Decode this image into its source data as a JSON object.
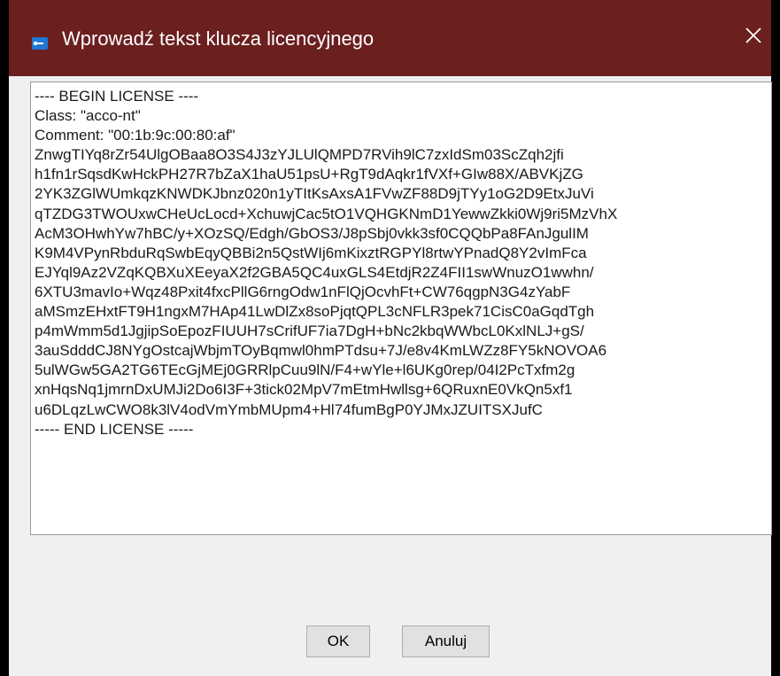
{
  "window": {
    "title": "Wprowadź tekst klucza licencyjnego",
    "close_glyph": "✕"
  },
  "license": {
    "lines": [
      "---- BEGIN LICENSE ----",
      "Class: \"acco-nt\"",
      "Comment: \"00:1b:9c:00:80:af\"",
      "ZnwgTIYq8rZr54UlgOBaa8O3S4J3zYJLUlQMPD7RVih9lC7zxIdSm03ScZqh2jfi",
      "h1fn1rSqsdKwHckPH27R7bZaX1haU51psU+RgT9dAqkr1fVXf+GIw88X/ABVKjZG",
      "2YK3ZGlWUmkqzKNWDKJbnz020n1yTItKsAxsA1FVwZF88D9jTYy1oG2D9EtxJuVi",
      "qTZDG3TWOUxwCHeUcLocd+XchuwjCac5tO1VQHGKNmD1YewwZkki0Wj9ri5MzVhX",
      "AcM3OHwhYw7hBC/y+XOzSQ/Edgh/GbOS3/J8pSbj0vkk3sf0CQQbPa8FAnJgulIM",
      "K9M4VPynRbduRqSwbEqyQBBi2n5QstWIj6mKixztRGPYl8rtwYPnadQ8Y2vImFca",
      "EJYql9Az2VZqKQBXuXEeyaX2f2GBA5QC4uxGLS4EtdjR2Z4FII1swWnuzO1wwhn/",
      "6XTU3mavIo+Wqz48Pxit4fxcPllG6rngOdw1nFlQjOcvhFt+CW76qgpN3G4zYabF",
      "aMSmzEHxtFT9H1ngxM7HAp41LwDlZx8soPjqtQPL3cNFLR3pek71CisC0aGqdTgh",
      "p4mWmm5d1JgjipSoEpozFIUUH7sCrifUF7ia7DgH+bNc2kbqWWbcL0KxlNLJ+gS/",
      "3auSdddCJ8NYgOstcajWbjmTOyBqmwl0hmPTdsu+7J/e8v4KmLWZz8FY5kNOVOA6",
      "5ulWGw5GA2TG6TEcGjMEj0GRRlpCuu9lN/F4+wYle+l6UKg0rep/04I2PcTxfm2g",
      "xnHqsNq1jmrnDxUMJi2Do6I3F+3tick02MpV7mEtmHwllsg+6QRuxnE0VkQn5xf1",
      "u6DLqzLwCWO8k3lV4odVmYmbMUpm4+Hl74fumBgP0YJMxJZUITSXJufC",
      "----- END LICENSE -----"
    ]
  },
  "buttons": {
    "ok_label": "OK",
    "cancel_label": "Anuluj"
  },
  "colors": {
    "titlebar": "#6b1f1f",
    "dialog_bg": "#f0f0f0",
    "button_bg": "#e1e1e1"
  },
  "icons": {
    "app": "java-app-icon",
    "close": "close-icon"
  }
}
